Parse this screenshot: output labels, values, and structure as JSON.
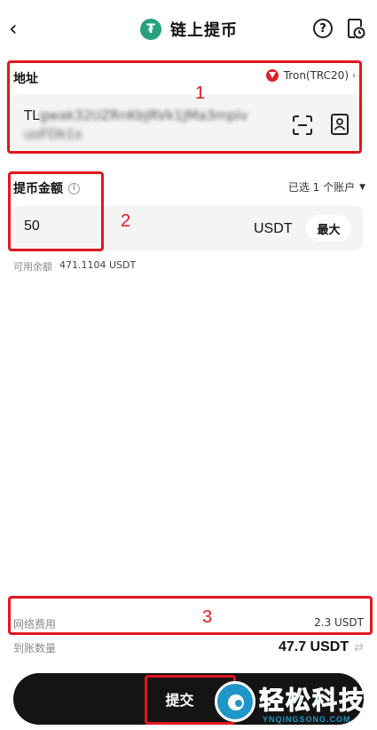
{
  "header": {
    "title": "链上提币",
    "back_glyph": "‹",
    "token_glyph": "₮",
    "help_glyph": "?",
    "colors": {
      "token": "#26a17b"
    }
  },
  "address": {
    "label": "地址",
    "network": "Tron(TRC20)",
    "network_caret": "›",
    "value_line1_clear": "TL",
    "value_line1_blurred": "gwak32UZRnKbJRVk1JMa3mpiv",
    "value_line2_blurred": "uoFDk1x"
  },
  "amount": {
    "label": "提币金额",
    "info_glyph": "i",
    "account_selector": "已选 1 个账户",
    "account_caret": "▼",
    "value": "50",
    "unit": "USDT",
    "max_label": "最大",
    "available_label": "可用余额",
    "available_value": "471.1104 USDT"
  },
  "fees": {
    "network_fee_label": "网络费用",
    "network_fee_value": "2.3 USDT",
    "receive_label": "到账数量",
    "receive_value": "47.7 USDT",
    "swap_glyph": "⇄"
  },
  "submit": {
    "label": "提交"
  },
  "annotations": {
    "n1": "1",
    "n2": "2",
    "n3": "3",
    "color": "#e0171f"
  },
  "watermark": {
    "text": "轻松科技",
    "sub": "YNQINGSONG.COM",
    "color": "#1e96c8"
  }
}
